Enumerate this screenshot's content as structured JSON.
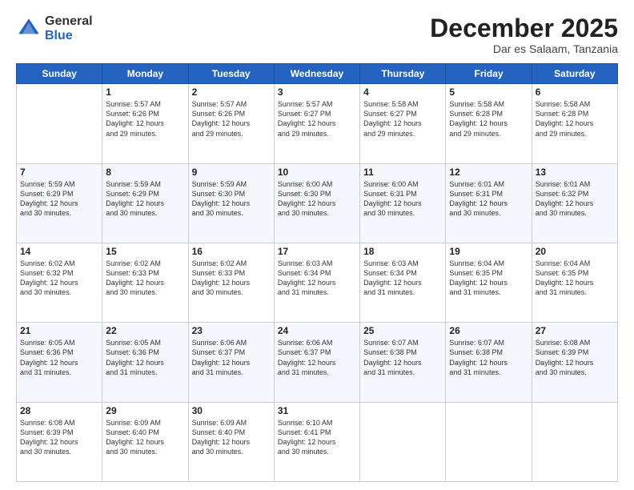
{
  "logo": {
    "general": "General",
    "blue": "Blue"
  },
  "header": {
    "month": "December 2025",
    "location": "Dar es Salaam, Tanzania"
  },
  "days_of_week": [
    "Sunday",
    "Monday",
    "Tuesday",
    "Wednesday",
    "Thursday",
    "Friday",
    "Saturday"
  ],
  "weeks": [
    [
      {
        "day": "",
        "info": ""
      },
      {
        "day": "1",
        "info": "Sunrise: 5:57 AM\nSunset: 6:26 PM\nDaylight: 12 hours\nand 29 minutes."
      },
      {
        "day": "2",
        "info": "Sunrise: 5:57 AM\nSunset: 6:26 PM\nDaylight: 12 hours\nand 29 minutes."
      },
      {
        "day": "3",
        "info": "Sunrise: 5:57 AM\nSunset: 6:27 PM\nDaylight: 12 hours\nand 29 minutes."
      },
      {
        "day": "4",
        "info": "Sunrise: 5:58 AM\nSunset: 6:27 PM\nDaylight: 12 hours\nand 29 minutes."
      },
      {
        "day": "5",
        "info": "Sunrise: 5:58 AM\nSunset: 6:28 PM\nDaylight: 12 hours\nand 29 minutes."
      },
      {
        "day": "6",
        "info": "Sunrise: 5:58 AM\nSunset: 6:28 PM\nDaylight: 12 hours\nand 29 minutes."
      }
    ],
    [
      {
        "day": "7",
        "info": "Sunrise: 5:59 AM\nSunset: 6:29 PM\nDaylight: 12 hours\nand 30 minutes."
      },
      {
        "day": "8",
        "info": "Sunrise: 5:59 AM\nSunset: 6:29 PM\nDaylight: 12 hours\nand 30 minutes."
      },
      {
        "day": "9",
        "info": "Sunrise: 5:59 AM\nSunset: 6:30 PM\nDaylight: 12 hours\nand 30 minutes."
      },
      {
        "day": "10",
        "info": "Sunrise: 6:00 AM\nSunset: 6:30 PM\nDaylight: 12 hours\nand 30 minutes."
      },
      {
        "day": "11",
        "info": "Sunrise: 6:00 AM\nSunset: 6:31 PM\nDaylight: 12 hours\nand 30 minutes."
      },
      {
        "day": "12",
        "info": "Sunrise: 6:01 AM\nSunset: 6:31 PM\nDaylight: 12 hours\nand 30 minutes."
      },
      {
        "day": "13",
        "info": "Sunrise: 6:01 AM\nSunset: 6:32 PM\nDaylight: 12 hours\nand 30 minutes."
      }
    ],
    [
      {
        "day": "14",
        "info": "Sunrise: 6:02 AM\nSunset: 6:32 PM\nDaylight: 12 hours\nand 30 minutes."
      },
      {
        "day": "15",
        "info": "Sunrise: 6:02 AM\nSunset: 6:33 PM\nDaylight: 12 hours\nand 30 minutes."
      },
      {
        "day": "16",
        "info": "Sunrise: 6:02 AM\nSunset: 6:33 PM\nDaylight: 12 hours\nand 30 minutes."
      },
      {
        "day": "17",
        "info": "Sunrise: 6:03 AM\nSunset: 6:34 PM\nDaylight: 12 hours\nand 31 minutes."
      },
      {
        "day": "18",
        "info": "Sunrise: 6:03 AM\nSunset: 6:34 PM\nDaylight: 12 hours\nand 31 minutes."
      },
      {
        "day": "19",
        "info": "Sunrise: 6:04 AM\nSunset: 6:35 PM\nDaylight: 12 hours\nand 31 minutes."
      },
      {
        "day": "20",
        "info": "Sunrise: 6:04 AM\nSunset: 6:35 PM\nDaylight: 12 hours\nand 31 minutes."
      }
    ],
    [
      {
        "day": "21",
        "info": "Sunrise: 6:05 AM\nSunset: 6:36 PM\nDaylight: 12 hours\nand 31 minutes."
      },
      {
        "day": "22",
        "info": "Sunrise: 6:05 AM\nSunset: 6:36 PM\nDaylight: 12 hours\nand 31 minutes."
      },
      {
        "day": "23",
        "info": "Sunrise: 6:06 AM\nSunset: 6:37 PM\nDaylight: 12 hours\nand 31 minutes."
      },
      {
        "day": "24",
        "info": "Sunrise: 6:06 AM\nSunset: 6:37 PM\nDaylight: 12 hours\nand 31 minutes."
      },
      {
        "day": "25",
        "info": "Sunrise: 6:07 AM\nSunset: 6:38 PM\nDaylight: 12 hours\nand 31 minutes."
      },
      {
        "day": "26",
        "info": "Sunrise: 6:07 AM\nSunset: 6:38 PM\nDaylight: 12 hours\nand 31 minutes."
      },
      {
        "day": "27",
        "info": "Sunrise: 6:08 AM\nSunset: 6:39 PM\nDaylight: 12 hours\nand 30 minutes."
      }
    ],
    [
      {
        "day": "28",
        "info": "Sunrise: 6:08 AM\nSunset: 6:39 PM\nDaylight: 12 hours\nand 30 minutes."
      },
      {
        "day": "29",
        "info": "Sunrise: 6:09 AM\nSunset: 6:40 PM\nDaylight: 12 hours\nand 30 minutes."
      },
      {
        "day": "30",
        "info": "Sunrise: 6:09 AM\nSunset: 6:40 PM\nDaylight: 12 hours\nand 30 minutes."
      },
      {
        "day": "31",
        "info": "Sunrise: 6:10 AM\nSunset: 6:41 PM\nDaylight: 12 hours\nand 30 minutes."
      },
      {
        "day": "",
        "info": ""
      },
      {
        "day": "",
        "info": ""
      },
      {
        "day": "",
        "info": ""
      }
    ]
  ]
}
